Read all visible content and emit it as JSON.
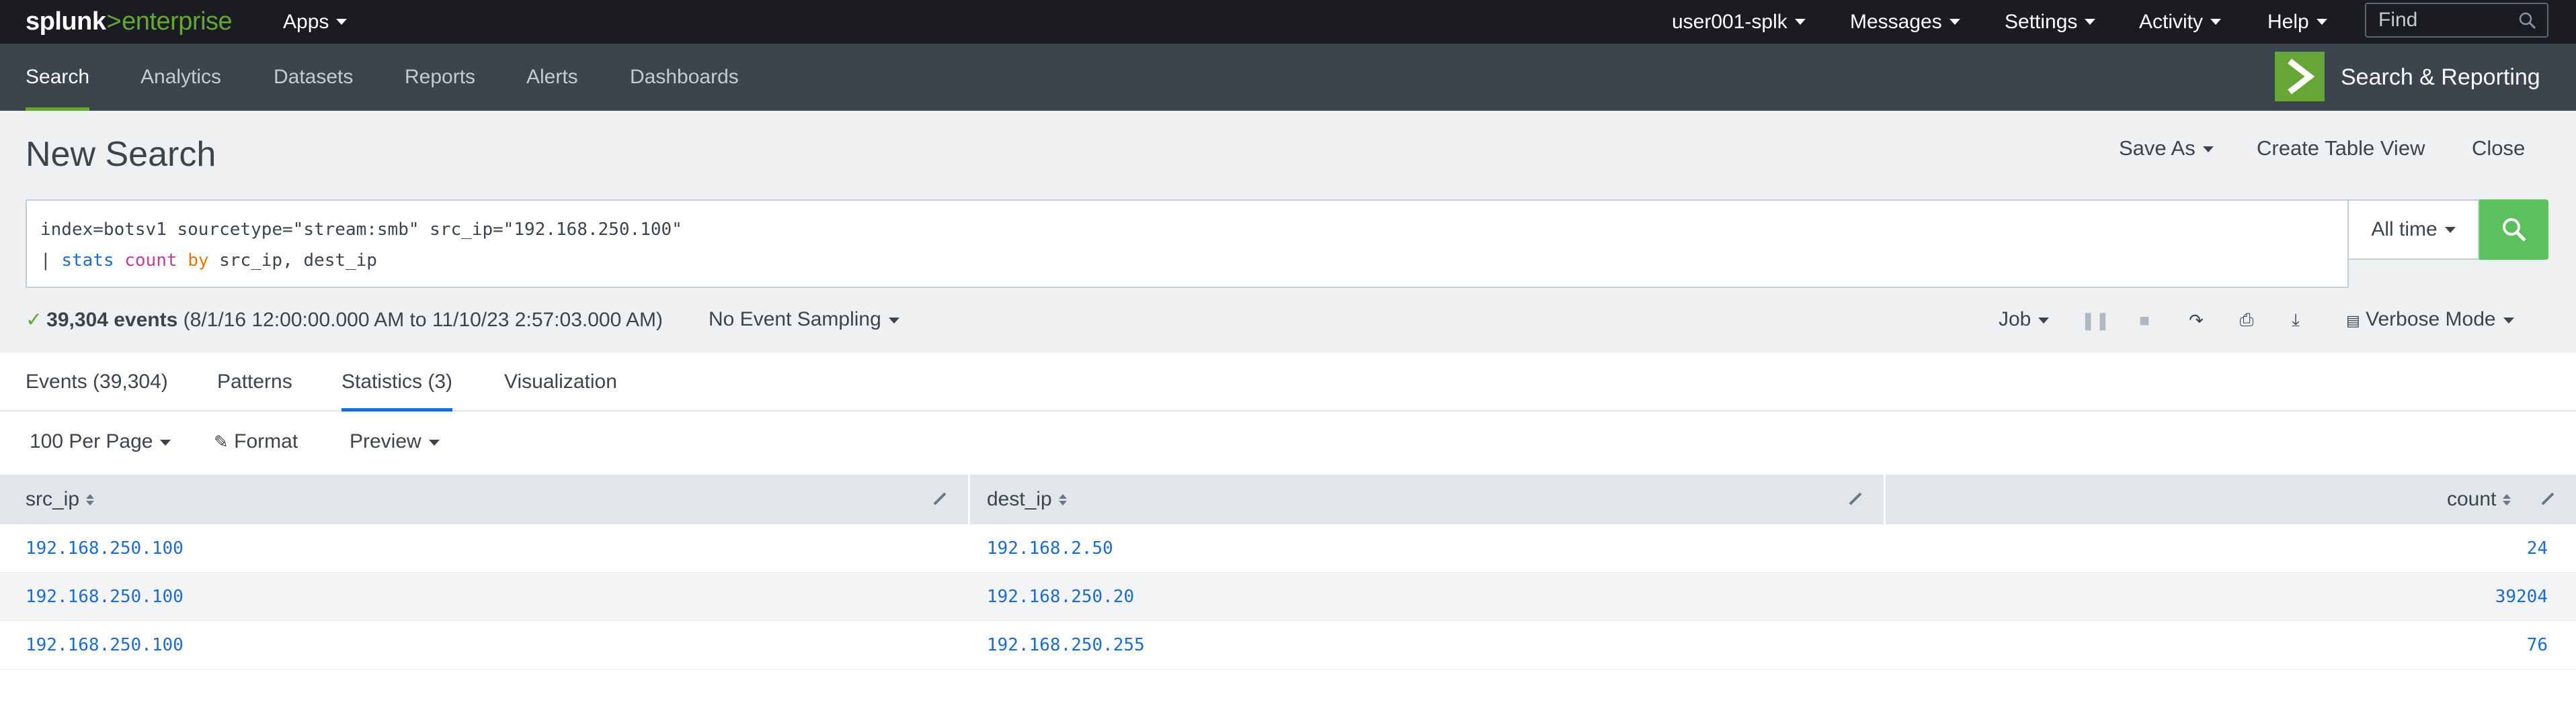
{
  "topbar": {
    "logo_brand": "splunk",
    "logo_sep": ">",
    "logo_product": "enterprise",
    "apps": "Apps",
    "user": "user001-splk",
    "messages": "Messages",
    "settings": "Settings",
    "activity": "Activity",
    "help": "Help",
    "find_placeholder": "Find"
  },
  "appbar": {
    "nav": [
      "Search",
      "Analytics",
      "Datasets",
      "Reports",
      "Alerts",
      "Dashboards"
    ],
    "active": "Search",
    "app_title": "Search & Reporting",
    "accent": "#65a637"
  },
  "header": {
    "title": "New Search",
    "save_as": "Save As",
    "create_table_view": "Create Table View",
    "close": "Close"
  },
  "search": {
    "line1": "index=botsv1 sourcetype=\"stream:smb\" src_ip=\"192.168.250.100\"",
    "pipe": "| ",
    "cmd": "stats",
    "func": "count",
    "by": "by",
    "fields": "src_ip, dest_ip",
    "time_range": "All time"
  },
  "status": {
    "events": "39,304 events",
    "range": "(8/1/16 12:00:00.000 AM to 11/10/23 2:57:03.000 AM)",
    "sampling": "No Event Sampling",
    "job": "Job",
    "mode": "Verbose Mode"
  },
  "tabs": [
    {
      "label": "Events (39,304)"
    },
    {
      "label": "Patterns"
    },
    {
      "label": "Statistics (3)"
    },
    {
      "label": "Visualization"
    }
  ],
  "table_controls": {
    "per_page": "100 Per Page",
    "format": "Format",
    "preview": "Preview"
  },
  "table": {
    "columns": [
      "src_ip",
      "dest_ip",
      "count"
    ],
    "rows": [
      {
        "src_ip": "192.168.250.100",
        "dest_ip": "192.168.2.50",
        "count": "24"
      },
      {
        "src_ip": "192.168.250.100",
        "dest_ip": "192.168.250.20",
        "count": "39204"
      },
      {
        "src_ip": "192.168.250.100",
        "dest_ip": "192.168.250.255",
        "count": "76"
      }
    ]
  }
}
